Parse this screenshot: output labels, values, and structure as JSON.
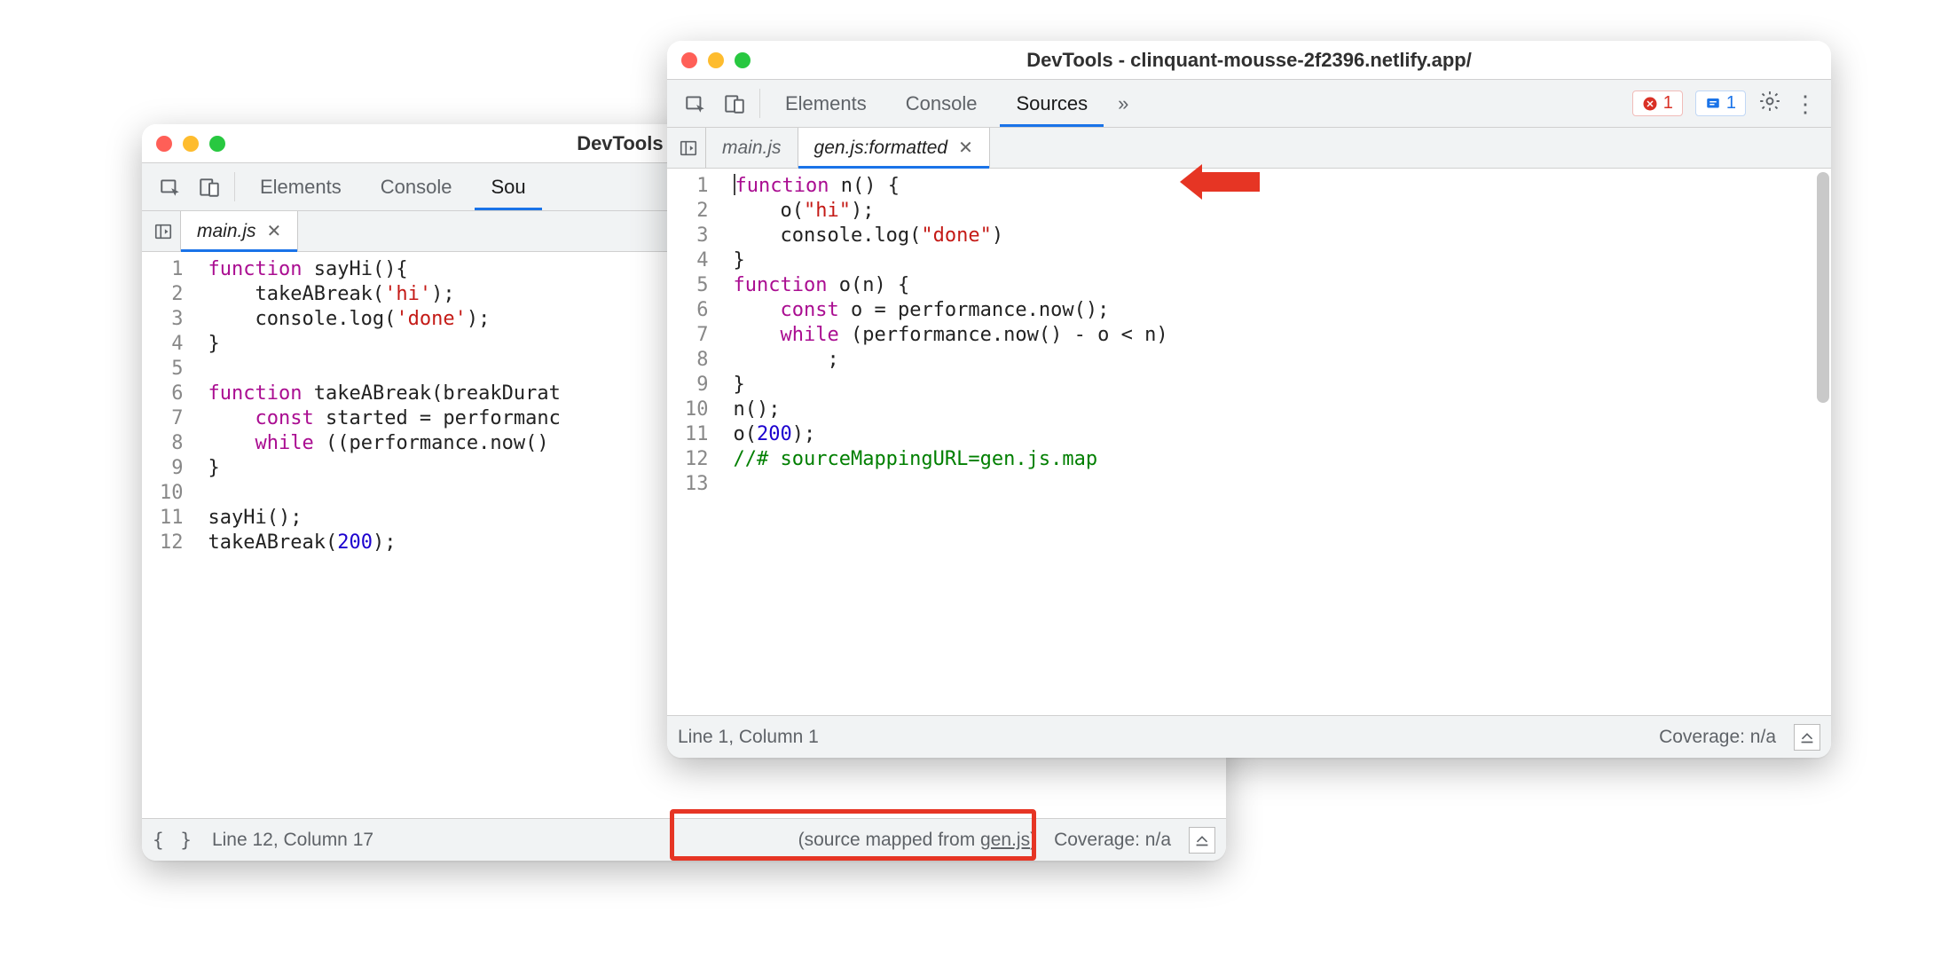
{
  "back_window": {
    "title": "DevTools - clinquant-m",
    "toolbar_tabs": {
      "elements": "Elements",
      "console": "Console",
      "sources": "Sou"
    },
    "file_tabs": [
      {
        "label": "main.js",
        "active": true
      }
    ],
    "code": {
      "lines": [
        {
          "n": 1,
          "segs": [
            {
              "t": "function ",
              "c": "kw"
            },
            {
              "t": "sayHi(){"
            }
          ]
        },
        {
          "n": 2,
          "segs": [
            {
              "t": "    takeABreak("
            },
            {
              "t": "'hi'",
              "c": "str"
            },
            {
              "t": ");"
            }
          ]
        },
        {
          "n": 3,
          "segs": [
            {
              "t": "    console.log("
            },
            {
              "t": "'done'",
              "c": "str"
            },
            {
              "t": ");"
            }
          ]
        },
        {
          "n": 4,
          "segs": [
            {
              "t": "}"
            }
          ]
        },
        {
          "n": 5,
          "segs": [
            {
              "t": ""
            }
          ]
        },
        {
          "n": 6,
          "segs": [
            {
              "t": "function ",
              "c": "kw"
            },
            {
              "t": "takeABreak(breakDurat"
            }
          ]
        },
        {
          "n": 7,
          "segs": [
            {
              "t": "    "
            },
            {
              "t": "const ",
              "c": "kw"
            },
            {
              "t": "started = performanc"
            }
          ]
        },
        {
          "n": 8,
          "segs": [
            {
              "t": "    "
            },
            {
              "t": "while ",
              "c": "kw"
            },
            {
              "t": "((performance.now() "
            }
          ]
        },
        {
          "n": 9,
          "segs": [
            {
              "t": "}"
            }
          ]
        },
        {
          "n": 10,
          "segs": [
            {
              "t": ""
            }
          ]
        },
        {
          "n": 11,
          "segs": [
            {
              "t": "sayHi();"
            }
          ]
        },
        {
          "n": 12,
          "segs": [
            {
              "t": "takeABreak("
            },
            {
              "t": "200",
              "c": "num"
            },
            {
              "t": ");"
            }
          ]
        }
      ]
    },
    "status": {
      "format_icon": "{ }",
      "position": "Line 12, Column 17",
      "source_mapped_prefix": "(source mapped from ",
      "source_mapped_link": "gen.js",
      "source_mapped_suffix": ")",
      "coverage": "Coverage: n/a"
    }
  },
  "front_window": {
    "title": "DevTools - clinquant-mousse-2f2396.netlify.app/",
    "toolbar_tabs": {
      "elements": "Elements",
      "console": "Console",
      "sources": "Sources",
      "more": "»"
    },
    "badges": {
      "errors": "1",
      "info": "1"
    },
    "file_tabs": [
      {
        "label": "main.js",
        "active": false
      },
      {
        "label": "gen.js:formatted",
        "active": true
      }
    ],
    "code": {
      "lines": [
        {
          "n": 1,
          "segs": [
            {
              "t": "function ",
              "c": "kw"
            },
            {
              "t": "n() {"
            }
          ]
        },
        {
          "n": 2,
          "segs": [
            {
              "t": "    o("
            },
            {
              "t": "\"hi\"",
              "c": "str"
            },
            {
              "t": ");"
            }
          ]
        },
        {
          "n": 3,
          "segs": [
            {
              "t": "    console.log("
            },
            {
              "t": "\"done\"",
              "c": "str"
            },
            {
              "t": ")"
            }
          ]
        },
        {
          "n": 4,
          "segs": [
            {
              "t": "}"
            }
          ]
        },
        {
          "n": 5,
          "segs": [
            {
              "t": "function ",
              "c": "kw"
            },
            {
              "t": "o(n) {"
            }
          ]
        },
        {
          "n": 6,
          "segs": [
            {
              "t": "    "
            },
            {
              "t": "const ",
              "c": "kw"
            },
            {
              "t": "o = performance.now();"
            }
          ]
        },
        {
          "n": 7,
          "segs": [
            {
              "t": "    "
            },
            {
              "t": "while ",
              "c": "kw"
            },
            {
              "t": "(performance.now() - o < n)"
            }
          ]
        },
        {
          "n": 8,
          "segs": [
            {
              "t": "        ;"
            }
          ]
        },
        {
          "n": 9,
          "segs": [
            {
              "t": "}"
            }
          ]
        },
        {
          "n": 10,
          "segs": [
            {
              "t": "n();"
            }
          ]
        },
        {
          "n": 11,
          "segs": [
            {
              "t": "o("
            },
            {
              "t": "200",
              "c": "num"
            },
            {
              "t": ");"
            }
          ]
        },
        {
          "n": 12,
          "segs": [
            {
              "t": "//# sourceMappingURL=gen.js.map",
              "c": "cm"
            }
          ]
        },
        {
          "n": 13,
          "segs": [
            {
              "t": ""
            }
          ]
        }
      ]
    },
    "status": {
      "position": "Line 1, Column 1",
      "coverage": "Coverage: n/a"
    }
  }
}
